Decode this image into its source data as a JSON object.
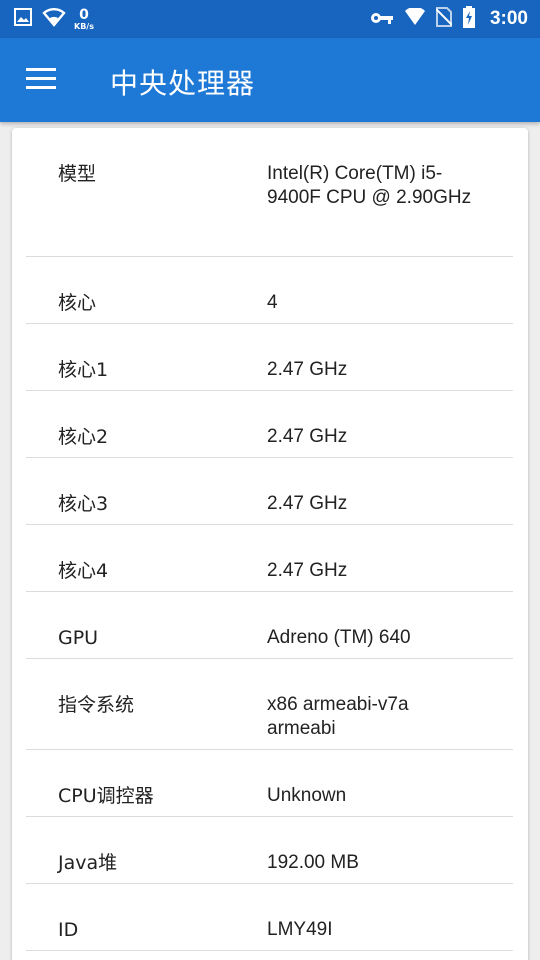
{
  "status_bar": {
    "kbs_value": "0",
    "kbs_unit": "KB/s",
    "time": "3:00"
  },
  "app_bar": {
    "title": "中央处理器"
  },
  "rows": [
    {
      "label": "模型",
      "value": "Intel(R) Core(TM) i5-9400F CPU @ 2.90GHz"
    },
    {
      "label": "核心",
      "value": "4"
    },
    {
      "label": "核心1",
      "value": "2.47 GHz"
    },
    {
      "label": "核心2",
      "value": "2.47 GHz"
    },
    {
      "label": "核心3",
      "value": "2.47 GHz"
    },
    {
      "label": "核心4",
      "value": "2.47 GHz"
    },
    {
      "label": "GPU",
      "value": "Adreno (TM) 640"
    },
    {
      "label": "指令系统",
      "value": "x86 armeabi-v7a armeabi"
    },
    {
      "label": "CPU调控器",
      "value": "Unknown"
    },
    {
      "label": "Java堆",
      "value": "192.00 MB"
    },
    {
      "label": "ID",
      "value": "LMY49I"
    }
  ]
}
